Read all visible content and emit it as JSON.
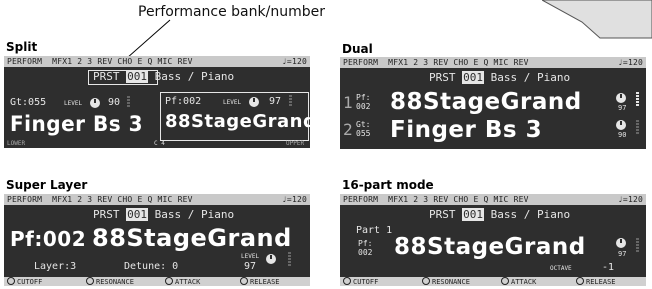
{
  "callout": "Performance bank/number",
  "sections": {
    "split": "Split",
    "dual": "Dual",
    "super_layer": "Super Layer",
    "part16": "16-part mode"
  },
  "topbar": {
    "mode": "PERFORM",
    "items": "MFX1 2 3 REV CHO E Q MIC REV",
    "tempo": "♩=120"
  },
  "prst": {
    "label": "PRST",
    "number": "001",
    "name": "Bass / Piano"
  },
  "split": {
    "left_code": "Gt:055",
    "level_label": "LEVEL",
    "left_level": "90",
    "left_name": "Finger Bs 3",
    "right_code": "Pf:002",
    "right_level": "97",
    "right_name": "88StageGrand",
    "lower": "LOWER",
    "split_point": "C 4",
    "upper": "UPPER"
  },
  "dual": {
    "part1_num": "1",
    "part1_code1": "Pf:",
    "part1_code2": "002",
    "part1_name": "88StageGrand",
    "part1_level": "97",
    "part2_num": "2",
    "part2_code1": "Gt:",
    "part2_code2": "055",
    "part2_name": "Finger Bs 3",
    "part2_level": "90"
  },
  "super": {
    "code": "Pf:002",
    "name": "88StageGrand",
    "layer": "Layer:3",
    "detune": "Detune: 0",
    "level_label": "LEVEL",
    "level": "97"
  },
  "part16": {
    "part": "Part 1",
    "code1": "Pf:",
    "code2": "002",
    "name": "88StageGrand",
    "level": "97",
    "octave_label": "OCTAVE",
    "octave": "-1"
  },
  "footer": [
    "CUTOFF",
    "RESONANCE",
    "ATTACK",
    "RELEASE"
  ]
}
